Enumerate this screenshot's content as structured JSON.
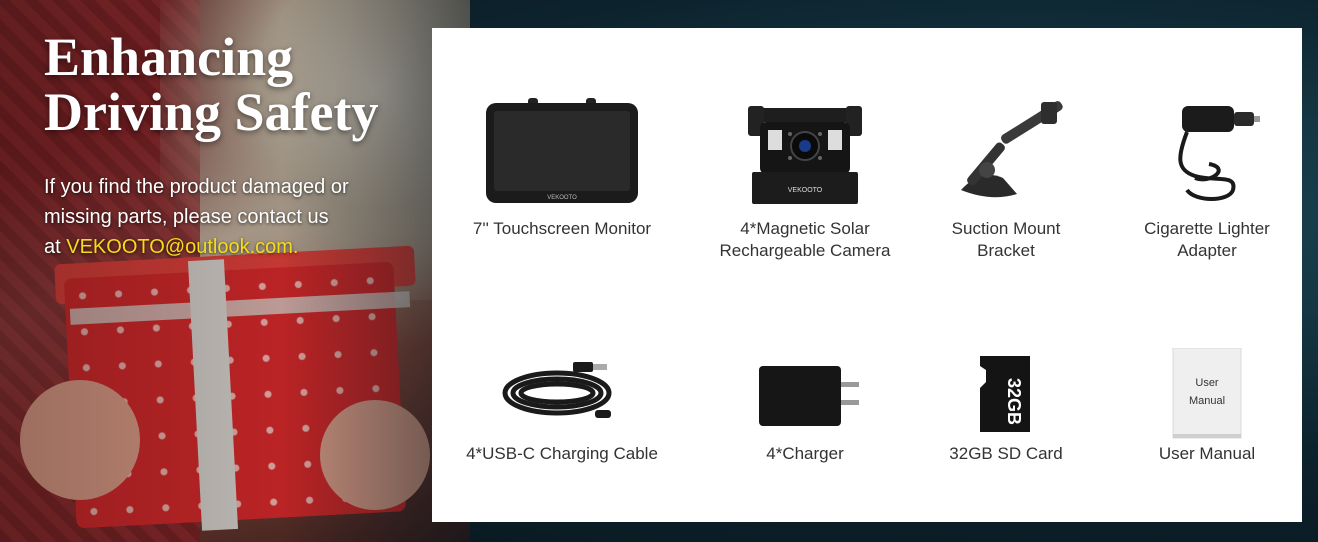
{
  "headline": {
    "line1": "Enhancing",
    "line2": "Driving Safety"
  },
  "notice": {
    "text_line1": "If you find the product damaged or",
    "text_line2": "missing parts, please contact us",
    "text_line3_prefix": "at ",
    "email": "VEKOOTO@outlook.com."
  },
  "colors": {
    "email_highlight": "#f5dc1a",
    "panel_bg": "#ffffff",
    "label_text": "#333333"
  },
  "brand_mark": "VEKOOTO",
  "items": [
    {
      "label_line1": "7'' Touchscreen Monitor",
      "label_line2": "",
      "icon": "monitor-icon"
    },
    {
      "label_line1": "4*Magnetic Solar",
      "label_line2": "Rechargeable Camera",
      "icon": "camera-icon"
    },
    {
      "label_line1": "Suction Mount",
      "label_line2": "Bracket",
      "icon": "suction-mount-icon"
    },
    {
      "label_line1": "Cigarette Lighter",
      "label_line2": "Adapter",
      "icon": "car-adapter-icon"
    },
    {
      "label_line1": "4*USB-C Charging Cable",
      "label_line2": "",
      "icon": "usb-cable-icon"
    },
    {
      "label_line1": "4*Charger",
      "label_line2": "",
      "icon": "charger-icon"
    },
    {
      "label_line1": "32GB SD Card",
      "label_line2": "",
      "icon": "sd-card-icon"
    },
    {
      "label_line1": "User Manual",
      "label_line2": "",
      "icon": "manual-icon"
    }
  ],
  "sd_card_text": "32GB",
  "manual_cover": {
    "line1": "User",
    "line2": "Manual"
  }
}
